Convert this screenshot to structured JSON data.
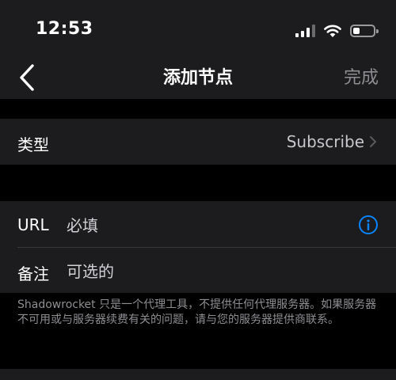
{
  "status_bar": {
    "time": "12:53",
    "icons": [
      "signal-icon",
      "wifi-icon",
      "battery-icon"
    ]
  },
  "nav": {
    "title": "添加节点",
    "done_label": "完成",
    "back_icon": "chevron-left-icon"
  },
  "type_row": {
    "label": "类型",
    "value": "Subscribe"
  },
  "url_row": {
    "label": "URL",
    "placeholder": "必填"
  },
  "remark_row": {
    "label": "备注",
    "placeholder": "可选的"
  },
  "footer_note": "Shadowrocket 只是一个代理工具，不提供任何代理服务器。如果服务器不可用或与服务器续费有关的问题，请与您的服务器提供商联系。",
  "colors": {
    "background": "#000000",
    "cell": "#1c1c1e",
    "accent_blue": "#0a84ff",
    "secondary_text": "#8e8e93"
  }
}
